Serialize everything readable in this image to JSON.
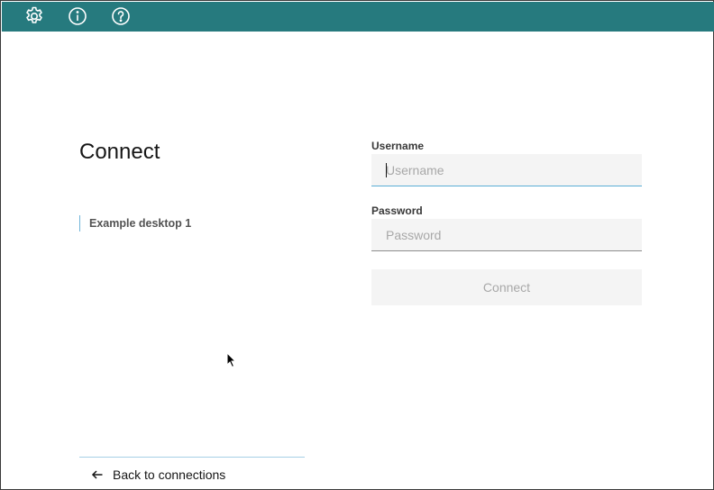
{
  "toolbar": {
    "icons": [
      "gear-icon",
      "info-icon",
      "help-icon"
    ],
    "color": "#267a7e"
  },
  "page": {
    "title": "Connect"
  },
  "connections": {
    "items": [
      {
        "label": "Example desktop 1"
      }
    ]
  },
  "form": {
    "username_label": "Username",
    "username_placeholder": "Username",
    "username_value": "",
    "password_label": "Password",
    "password_placeholder": "Password",
    "password_value": "",
    "connect_label": "Connect"
  },
  "footer": {
    "back_label": "Back to connections"
  }
}
